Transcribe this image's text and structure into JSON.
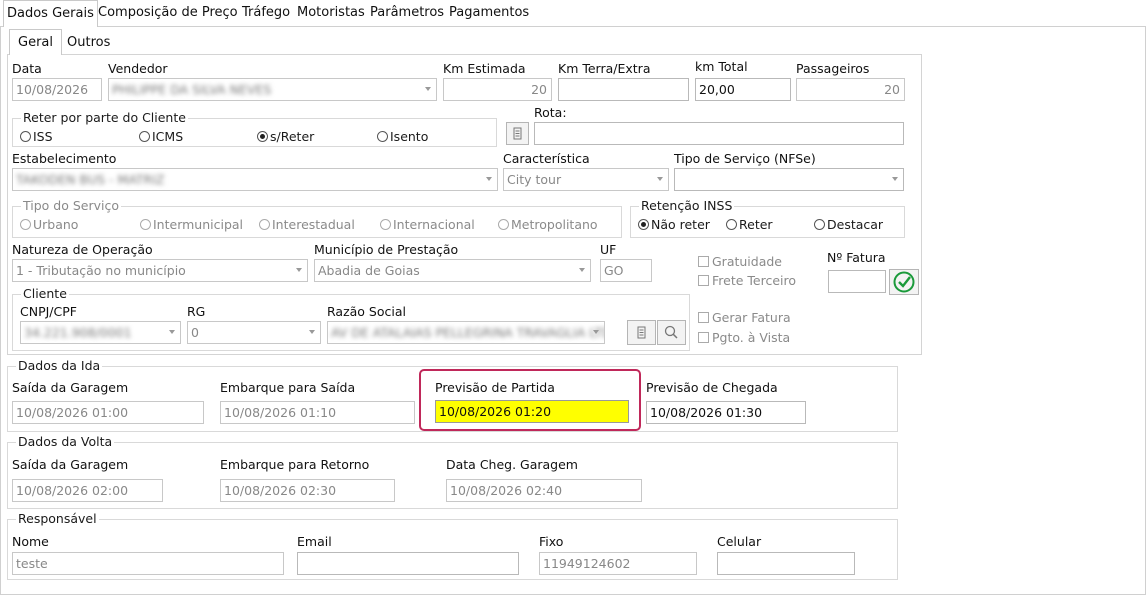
{
  "tabs": [
    "Dados Gerais",
    "Composição de Preço",
    "Tráfego",
    "Motoristas",
    "Parâmetros",
    "Pagamentos"
  ],
  "subtabs": [
    "Geral",
    "Outros"
  ],
  "geral": {
    "data_label": "Data",
    "data_value": "10/08/2026",
    "vendedor_label": "Vendedor",
    "vendedor_value": "PHILIPPE DA SILVA NEVES",
    "km_estimada_label": "Km Estimada",
    "km_estimada_value": "20",
    "km_terra_label": "Km Terra/Extra",
    "km_terra_value": "",
    "km_total_label": "km Total",
    "km_total_value": "20,00",
    "passageiros_label": "Passageiros",
    "passageiros_value": "20",
    "reter_title": "Reter por parte do Cliente",
    "reter_options": [
      "ISS",
      "ICMS",
      "s/Reter",
      "Isento"
    ],
    "reter_selected": "s/Reter",
    "rota_label": "Rota:",
    "rota_value": "",
    "estabelecimento_label": "Estabelecimento",
    "estabelecimento_value": "TAKODEN BUS - MATRIZ",
    "caracteristica_label": "Característica",
    "caracteristica_value": "City tour",
    "tipo_servico_nfse_label": "Tipo de Serviço (NFSe)",
    "tipo_servico_nfse_value": "",
    "tipo_servico_title": "Tipo do Serviço",
    "tipo_servico_options": [
      "Urbano",
      "Intermunicipal",
      "Interestadual",
      "Internacional",
      "Metropolitano"
    ],
    "retencao_title": "Retenção INSS",
    "retencao_options": [
      "Não reter",
      "Reter",
      "Destacar"
    ],
    "retencao_selected": "Não reter",
    "natureza_label": "Natureza de Operação",
    "natureza_value": "1 - Tributação no município",
    "municipio_label": "Município de Prestação",
    "municipio_value": "Abadia de Goias",
    "uf_label": "UF",
    "uf_value": "GO",
    "gratuidade_label": "Gratuidade",
    "frete_terceiro_label": "Frete Terceiro",
    "gerar_fatura_label": "Gerar Fatura",
    "pgto_vista_label": "Pgto. à Vista",
    "nro_fatura_label": "Nº Fatura",
    "nro_fatura_value": "",
    "cliente_title": "Cliente",
    "cnpj_label": "CNPJ/CPF",
    "cnpj_value": "34.221.908/0001",
    "rg_label": "RG",
    "rg_value": "0",
    "razao_label": "Razão Social",
    "razao_value": "AV DE ATALAIAS PELLEGRINA TRAVAGLIA LTDA"
  },
  "ida": {
    "title": "Dados da Ida",
    "saida_garagem_label": "Saída da Garagem",
    "saida_garagem_value": "10/08/2026 01:00",
    "embarque_label": "Embarque para Saída",
    "embarque_value": "10/08/2026 01:10",
    "prev_partida_label": "Previsão de Partida",
    "prev_partida_value": "10/08/2026 01:20",
    "prev_chegada_label": "Previsão de Chegada",
    "prev_chegada_value": "10/08/2026 01:30"
  },
  "volta": {
    "title": "Dados da Volta",
    "saida_garagem_label": "Saída da Garagem",
    "saida_garagem_value": "10/08/2026 02:00",
    "embarque_label": "Embarque para Retorno",
    "embarque_value": "10/08/2026 02:30",
    "cheg_garagem_label": "Data Cheg. Garagem",
    "cheg_garagem_value": "10/08/2026 02:40"
  },
  "responsavel": {
    "title": "Responsável",
    "nome_label": "Nome",
    "nome_value": "teste",
    "email_label": "Email",
    "email_value": "",
    "fixo_label": "Fixo",
    "fixo_value": "11949124602",
    "celular_label": "Celular",
    "celular_value": ""
  },
  "colors": {
    "highlight": "#ffff00",
    "focus_border": "#c0285a",
    "ok_check": "#1a9a3a"
  }
}
